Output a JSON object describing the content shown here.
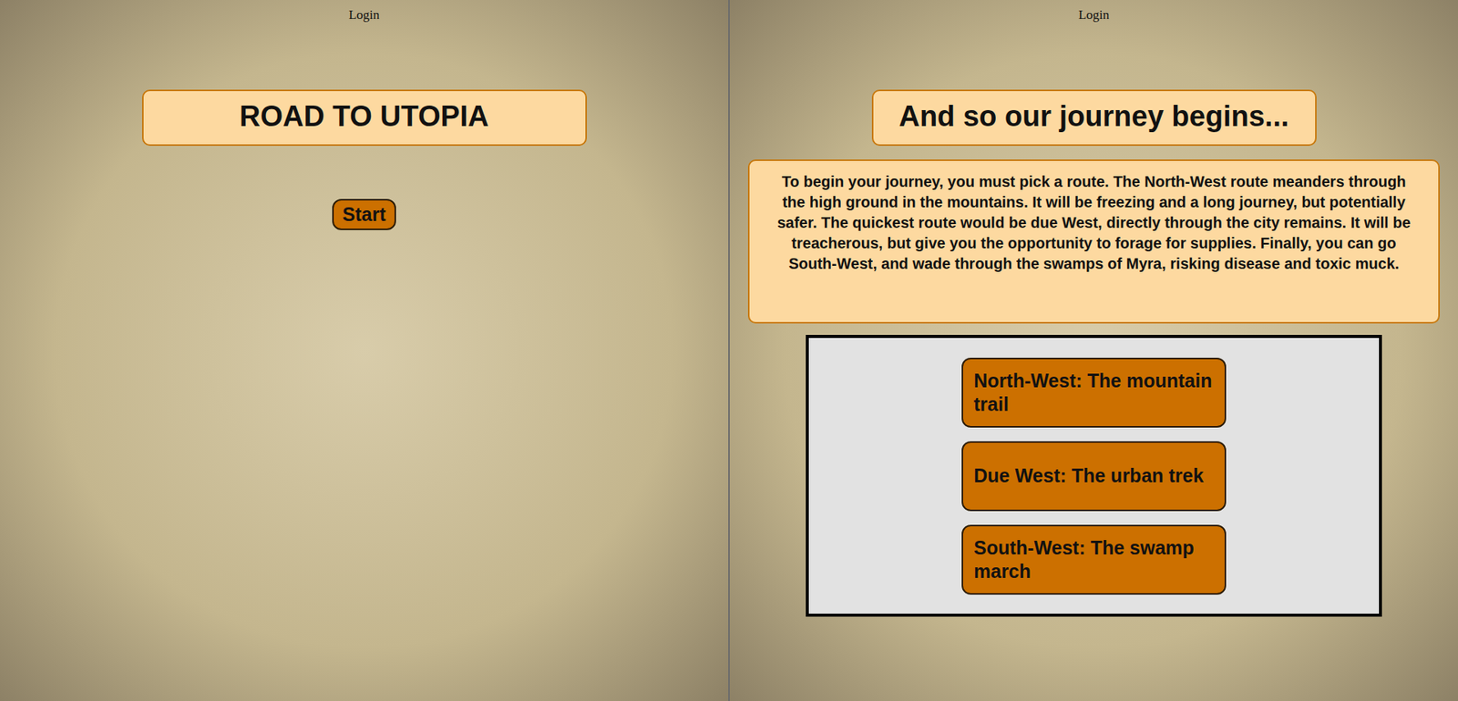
{
  "left_screen": {
    "login": "Login",
    "title": "ROAD TO UTOPIA",
    "start_button": "Start"
  },
  "right_screen": {
    "login": "Login",
    "title": "And so our journey begins...",
    "description": "To begin your journey, you must pick a route. The North-West route meanders through the high ground in the mountains. It will be freezing and a long journey, but potentially safer. The quickest route would be due West, directly through the city remains. It will be treacherous, but give you the opportunity to forage for supplies. Finally, you can go South-West, and wade through the swamps of Myra, risking disease and toxic muck.",
    "options": [
      "North-West: The mountain trail",
      "Due West: The urban trek",
      "South-West: The swamp march"
    ]
  }
}
